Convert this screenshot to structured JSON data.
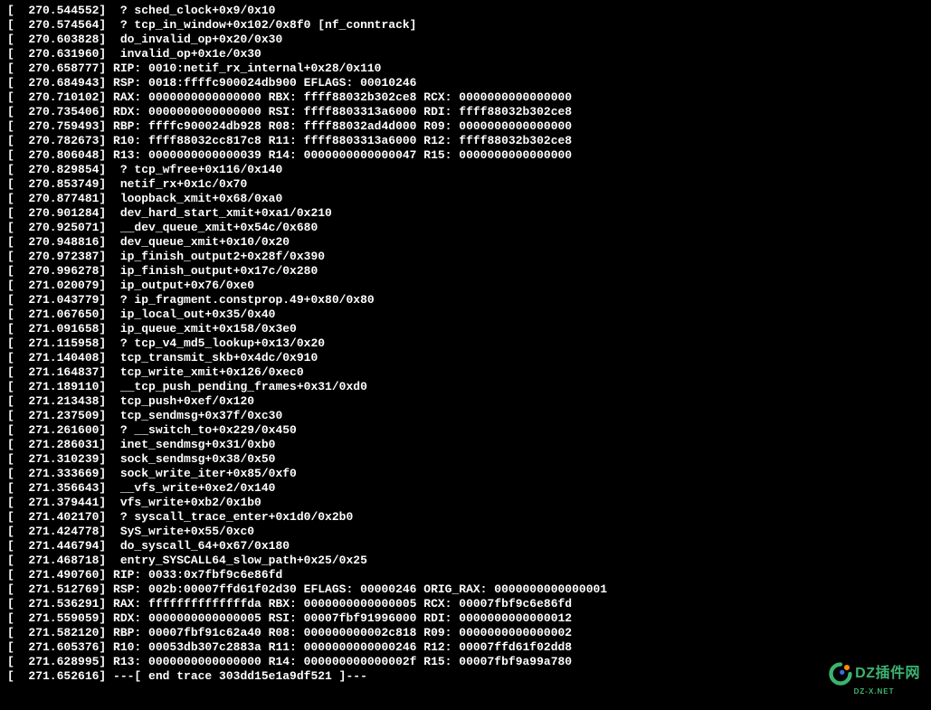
{
  "terminal": {
    "lines": [
      "[  270.544552]  ? sched_clock+0x9/0x10",
      "[  270.574564]  ? tcp_in_window+0x102/0x8f0 [nf_conntrack]",
      "[  270.603828]  do_invalid_op+0x20/0x30",
      "[  270.631960]  invalid_op+0x1e/0x30",
      "[  270.658777] RIP: 0010:netif_rx_internal+0x28/0x110",
      "[  270.684943] RSP: 0018:ffffc900024db900 EFLAGS: 00010246",
      "[  270.710102] RAX: 0000000000000000 RBX: ffff88032b302ce8 RCX: 0000000000000000",
      "[  270.735406] RDX: 0000000000000000 RSI: ffff8803313a6000 RDI: ffff88032b302ce8",
      "[  270.759493] RBP: ffffc900024db928 R08: ffff88032ad4d000 R09: 0000000000000000",
      "[  270.782673] R10: ffff88032cc817c8 R11: ffff8803313a6000 R12: ffff88032b302ce8",
      "[  270.806048] R13: 0000000000000039 R14: 0000000000000047 R15: 0000000000000000",
      "[  270.829854]  ? tcp_wfree+0x116/0x140",
      "[  270.853749]  netif_rx+0x1c/0x70",
      "[  270.877481]  loopback_xmit+0x68/0xa0",
      "[  270.901284]  dev_hard_start_xmit+0xa1/0x210",
      "[  270.925071]  __dev_queue_xmit+0x54c/0x680",
      "[  270.948816]  dev_queue_xmit+0x10/0x20",
      "[  270.972387]  ip_finish_output2+0x28f/0x390",
      "[  270.996278]  ip_finish_output+0x17c/0x280",
      "[  271.020079]  ip_output+0x76/0xe0",
      "[  271.043779]  ? ip_fragment.constprop.49+0x80/0x80",
      "[  271.067650]  ip_local_out+0x35/0x40",
      "[  271.091658]  ip_queue_xmit+0x158/0x3e0",
      "[  271.115958]  ? tcp_v4_md5_lookup+0x13/0x20",
      "[  271.140408]  tcp_transmit_skb+0x4dc/0x910",
      "[  271.164837]  tcp_write_xmit+0x126/0xec0",
      "[  271.189110]  __tcp_push_pending_frames+0x31/0xd0",
      "[  271.213438]  tcp_push+0xef/0x120",
      "[  271.237509]  tcp_sendmsg+0x37f/0xc30",
      "[  271.261600]  ? __switch_to+0x229/0x450",
      "[  271.286031]  inet_sendmsg+0x31/0xb0",
      "[  271.310239]  sock_sendmsg+0x38/0x50",
      "[  271.333669]  sock_write_iter+0x85/0xf0",
      "[  271.356643]  __vfs_write+0xe2/0x140",
      "[  271.379441]  vfs_write+0xb2/0x1b0",
      "[  271.402170]  ? syscall_trace_enter+0x1d0/0x2b0",
      "[  271.424778]  SyS_write+0x55/0xc0",
      "[  271.446794]  do_syscall_64+0x67/0x180",
      "[  271.468718]  entry_SYSCALL64_slow_path+0x25/0x25",
      "[  271.490760] RIP: 0033:0x7fbf9c6e86fd",
      "[  271.512769] RSP: 002b:00007ffd61f02d30 EFLAGS: 00000246 ORIG_RAX: 0000000000000001",
      "[  271.536291] RAX: ffffffffffffffda RBX: 0000000000000005 RCX: 00007fbf9c6e86fd",
      "[  271.559059] RDX: 0000000000000005 RSI: 00007fbf91996000 RDI: 0000000000000012",
      "[  271.582120] RBP: 00007fbf91c62a40 R08: 000000000002c818 R09: 0000000000000002",
      "[  271.605376] R10: 00053db307c2883a R11: 0000000000000246 R12: 00007ffd61f02dd8",
      "[  271.628995] R13: 0000000000000000 R14: 000000000000002f R15: 00007fbf9a99a780",
      "[  271.652616] ---[ end trace 303dd15e1a9df521 ]---"
    ]
  },
  "watermark": {
    "main_text": "DZ插件网",
    "sub_text": "DZ-X.NET"
  }
}
